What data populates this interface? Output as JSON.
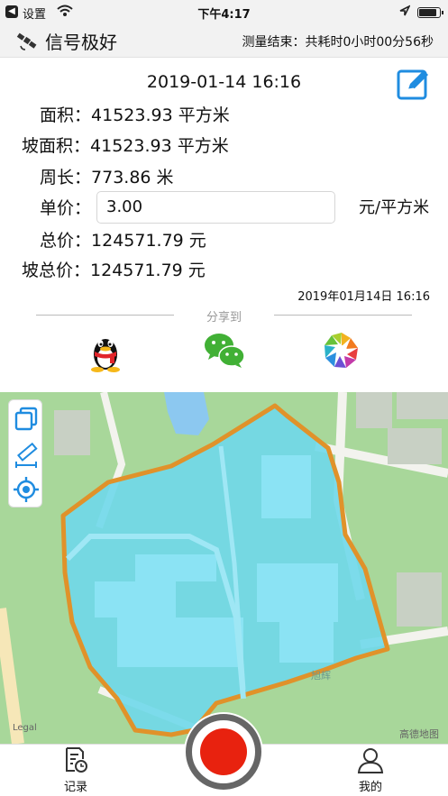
{
  "status_bar": {
    "back_label": "设置",
    "time": "下午4:17"
  },
  "header": {
    "signal_label": "信号极好",
    "timer": "测量结束：共耗时0小时00分56秒"
  },
  "record": {
    "datetime": "2019-01-14 16:16",
    "area_label": "面积：",
    "area_value": "41523.93 平方米",
    "slope_area_label": "坡面积：",
    "slope_area_value": "41523.93 平方米",
    "perimeter_label": "周长：",
    "perimeter_value": "773.86 米",
    "unit_price_label": "单价：",
    "unit_price_value": "3.00",
    "unit_price_unit": "元/平方米",
    "total_label": "总价：",
    "total_value": "124571.79 元",
    "slope_total_label": "坡总价：",
    "slope_total_value": "124571.79 元",
    "record_time": "2019年01月14日 16:16"
  },
  "share": {
    "title": "分享到",
    "targets": [
      "qq-icon",
      "wechat-icon",
      "moments-icon"
    ]
  },
  "map": {
    "legal": "Legal",
    "provider": "高德地图",
    "road_label": "旭辉"
  },
  "tabs": {
    "records": "记录",
    "mine": "我的"
  },
  "colors": {
    "accent": "#1f8ce0",
    "polygon_fill": "#6fd8ea",
    "polygon_stroke": "#e0922a",
    "record": "#e8220f"
  }
}
